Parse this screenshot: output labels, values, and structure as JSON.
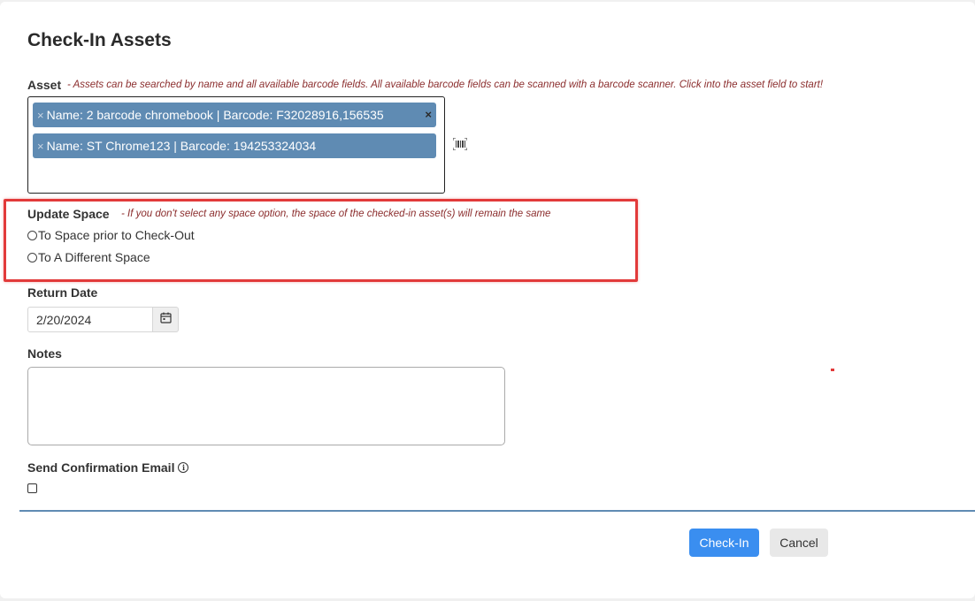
{
  "dialog": {
    "title": "Check-In Assets"
  },
  "asset": {
    "label": "Asset",
    "hint": "- Assets can be searched by name and all available barcode fields. All available barcode fields can be scanned with a barcode scanner. Click into the asset field to start!",
    "chips": [
      {
        "remove_symbol": "×",
        "text": "Name: 2 barcode chromebook | Barcode: F32028916,156535"
      },
      {
        "remove_symbol": "×",
        "text": "Name: ST Chrome123 | Barcode: 194253324034"
      }
    ],
    "clear_all_symbol": "×",
    "scanner_icon": "barcode-scanner-icon"
  },
  "update_space": {
    "label": "Update Space",
    "hint": "- If you don't select any space option, the space of the checked-in asset(s) will remain the same",
    "options": [
      {
        "label": "To Space prior to Check-Out",
        "selected": false
      },
      {
        "label": "To A Different Space",
        "selected": false
      }
    ],
    "highlight_color": "#e23a3a"
  },
  "return_date": {
    "label": "Return Date",
    "value": "2/20/2024",
    "calendar_icon": "calendar-icon"
  },
  "notes": {
    "label": "Notes",
    "value": ""
  },
  "confirmation_email": {
    "label": "Send Confirmation Email",
    "info_icon": "info-icon",
    "info_symbol": "i",
    "checked": false
  },
  "actions": {
    "primary_label": "Check-In",
    "secondary_label": "Cancel",
    "primary_color": "#3a8ef0"
  }
}
